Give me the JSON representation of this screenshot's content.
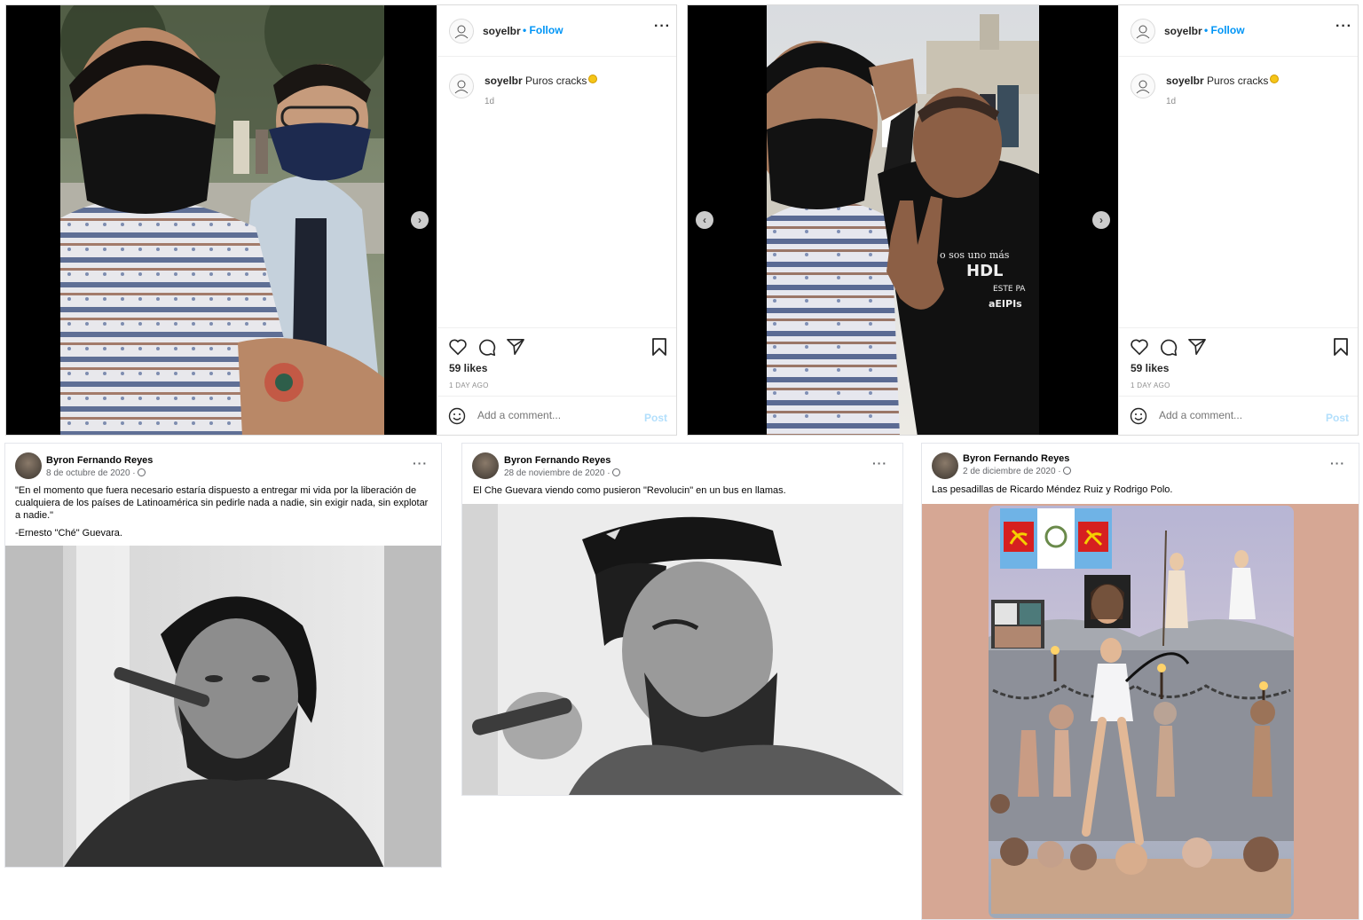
{
  "instagram_posts": [
    {
      "username": "soyelbr",
      "follow": "Follow",
      "caption_user": "soyelbr",
      "caption_text": "Puros cracks",
      "caption_time": "1d",
      "likes": "59 likes",
      "posted_ago": "1 DAY AGO",
      "comment_placeholder": "Add a comment...",
      "post_button": "Post"
    },
    {
      "username": "soyelbr",
      "follow": "Follow",
      "caption_user": "soyelbr",
      "caption_text": "Puros cracks",
      "caption_time": "1d",
      "likes": "59 likes",
      "posted_ago": "1 DAY AGO",
      "comment_placeholder": "Add a comment...",
      "post_button": "Post"
    }
  ],
  "facebook_posts": [
    {
      "author": "Byron Fernando Reyes",
      "date": "8 de octubre de 2020 ·",
      "text_lines": [
        "\"En el momento que fuera necesario estaría dispuesto a entregar mi vida por la liberación de",
        "cualquiera de los países de Latinoamérica sin pedirle nada a nadie, sin exigir nada, sin explotar",
        "a nadie.\""
      ],
      "attribution": "-Ernesto \"Ché\" Guevara."
    },
    {
      "author": "Byron Fernando Reyes",
      "date": "28 de noviembre de 2020 ·",
      "text": "El Che Guevara viendo como pusieron \"Revolucin\" en un bus en llamas."
    },
    {
      "author": "Byron Fernando Reyes",
      "date": "2 de diciembre de 2020 ·",
      "text": "Las pesadillas de Ricardo Méndez Ruiz y Rodrigo Polo."
    }
  ],
  "tshirt_text": [
    "o sos uno más",
    "HDL",
    "ESTE PA",
    "aEIPIs"
  ],
  "colors": {
    "follow_blue": "#0095f6",
    "post_disabled_blue": "#b2dffc",
    "fb_pink_background": "#d6a794"
  }
}
